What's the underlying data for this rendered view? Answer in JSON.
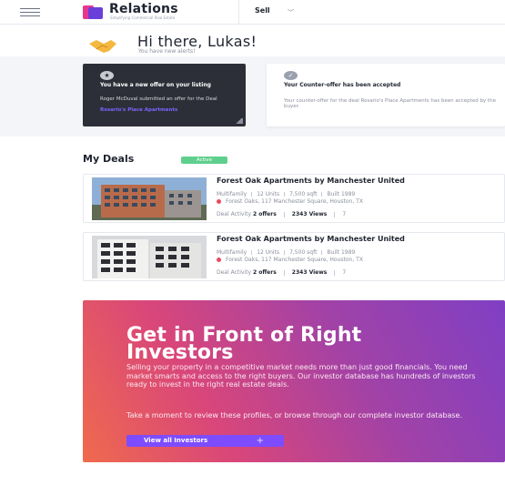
{
  "header": {
    "brand_name": "Relations",
    "brand_tagline": "Simplifying Commercial Real Estate",
    "mode_select": "Sell",
    "icons": [
      "menu-icon",
      "logo-icon",
      "chevron-down-icon"
    ]
  },
  "greeting": {
    "title": "Hi there, Lukas!",
    "subtitle": "You have new alerts!",
    "icon": "handshake-icon"
  },
  "alerts": [
    {
      "title": "You have a new offer on your listing",
      "body": "Roger McDuval submitted an offer for the Deal",
      "link": "Rosario's Place Apartments",
      "icon": "star-icon",
      "theme": "#2d2f38"
    },
    {
      "title": "Your Counter-offer has been accepted",
      "body": "Your counter-offer for the deal Rosario's Place Apartments has been accepted by the buyer.",
      "icon": "check-icon",
      "theme": "#ffffff"
    }
  ],
  "deals": {
    "title": "My Deals",
    "badge": "Active",
    "badge_color": "#5fcf8e",
    "items": [
      {
        "name": "Forest Oak Apartments by Manchester United",
        "type": "Multifamily",
        "units": "12 Units",
        "size": "7,500 sqft",
        "built": "Built 1989",
        "location": "Forest Oaks, 117 Manchester Square, Houston, TX",
        "activity_label": "Deal Activity",
        "offers": "2 offers",
        "views": "2343 Views",
        "extra": "7"
      },
      {
        "name": "Forest Oak Apartments by Manchester United",
        "type": "Multifamily",
        "units": "12 Units",
        "size": "7,500 sqft",
        "built": "Built 1989",
        "location": "Forest Oaks, 117 Manchester Square, Houston, TX",
        "activity_label": "Deal Activity",
        "offers": "2 offers",
        "views": "2343 Views",
        "extra": "7"
      }
    ]
  },
  "promo": {
    "title": "Get in Front of Right Investors",
    "body": "Selling your property in a competitive market needs more than just good financials. You need market smarts and access to the right buyers. Our investor database has hundreds of investors ready to invest in the right real estate deals.",
    "body2": "Take a moment to review these profiles, or browse through our complete investor database.",
    "button": "View all Investors",
    "colors": {
      "start": "#f06a4d",
      "mid": "#a042a8",
      "end": "#7f3fc4",
      "button": "#7d4cff"
    }
  }
}
